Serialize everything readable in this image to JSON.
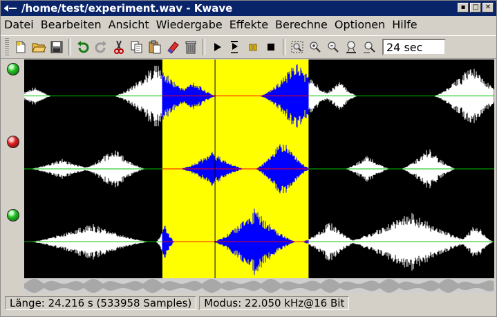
{
  "window": {
    "title": "/home/test/experiment.wav - Kwave",
    "buttons": [
      "minimize",
      "maximize",
      "close"
    ]
  },
  "menubar": {
    "items": [
      {
        "label": "Datei",
        "mnemonic": "D"
      },
      {
        "label": "Bearbeiten",
        "mnemonic": "B"
      },
      {
        "label": "Ansicht",
        "mnemonic": "A"
      },
      {
        "label": "Wiedergabe",
        "mnemonic": "W"
      },
      {
        "label": "Effekte",
        "mnemonic": "E"
      },
      {
        "label": "Berechne",
        "mnemonic": "r"
      },
      {
        "label": "Optionen",
        "mnemonic": "O"
      },
      {
        "label": "Hilfe",
        "mnemonic": "H"
      }
    ]
  },
  "toolbar": {
    "file_icons": [
      "new-file-icon",
      "open-folder-icon",
      "save-disk-icon"
    ],
    "edit_icons": [
      "undo-icon",
      "redo-icon",
      "cut-scissors-icon",
      "copy-icon",
      "paste-icon",
      "erase-icon",
      "delete-trash-icon"
    ],
    "playback_icons": [
      "play-icon",
      "loop-play-icon",
      "pause-icon",
      "stop-icon"
    ],
    "zoom_icons": [
      "zoom-selection-icon",
      "zoom-in-icon",
      "zoom-out-icon",
      "zoom-normal-icon",
      "zoom-all-icon"
    ],
    "zoom_value": "24 sec"
  },
  "tracks": [
    {
      "state": "enabled",
      "led_color": "#1fc01f"
    },
    {
      "state": "selected",
      "led_color": "#e02020"
    },
    {
      "state": "enabled",
      "led_color": "#1fc01f"
    }
  ],
  "colors": {
    "signal": "#ffffff",
    "selection_background": "#ffff00",
    "selection_signal": "#0000ff",
    "zero_line": "#00c000",
    "selection_zero_line": "#ff0000",
    "background": "#000000"
  },
  "selection": {
    "start_fraction": 0.294,
    "end_fraction": 0.605,
    "cursor_fraction": 0.406
  },
  "statusbar": {
    "length": "Länge: 24.216 s (533958 Samples)",
    "mode": "Modus: 22.050 kHz@16 Bit"
  }
}
